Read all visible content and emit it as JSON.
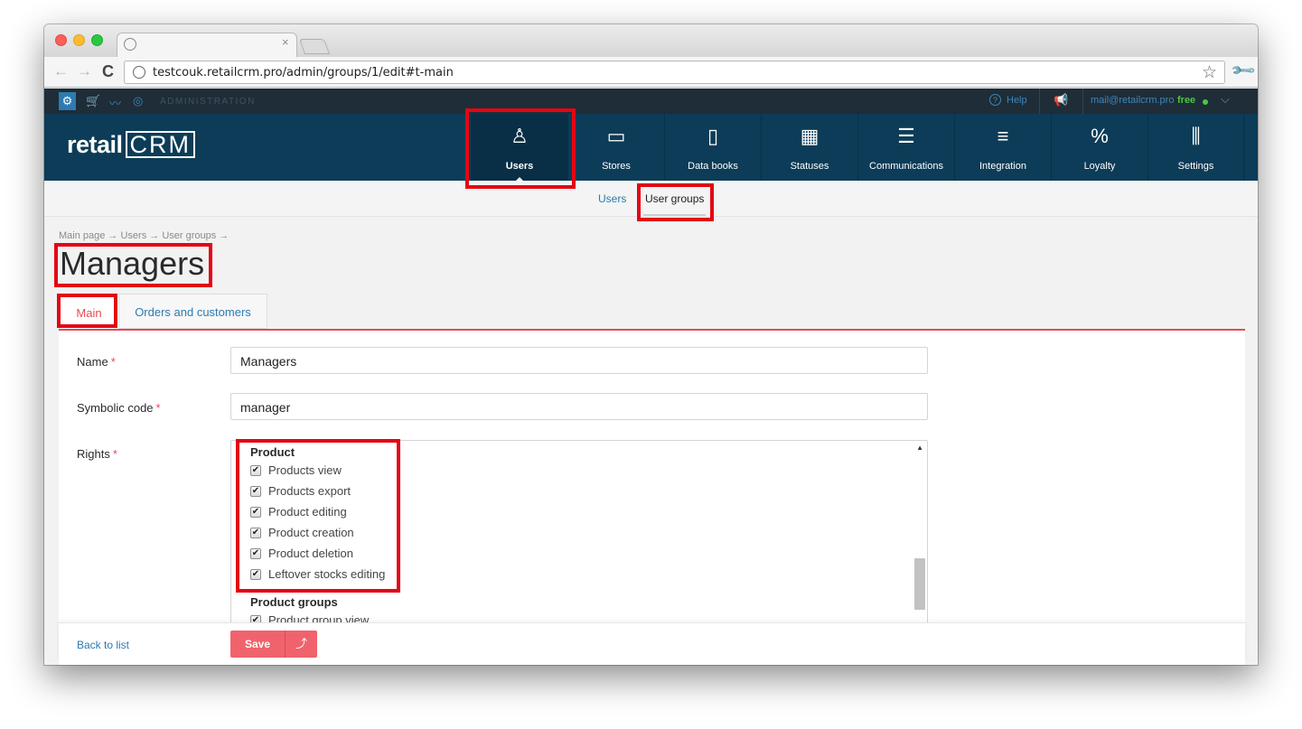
{
  "browser": {
    "url": "testcouk.retailcrm.pro/admin/groups/1/edit#t-main",
    "tab_close": "×"
  },
  "adminbar": {
    "label": "ADMINISTRATION",
    "help": "Help",
    "email": "mail@retailcrm.pro",
    "plan": "free"
  },
  "logo": {
    "text": "retail",
    "crm": "CRM"
  },
  "nav": {
    "items": [
      {
        "label": "Users",
        "icon": "user-icon",
        "active": true
      },
      {
        "label": "Stores",
        "icon": "store-icon"
      },
      {
        "label": "Data books",
        "icon": "book-icon"
      },
      {
        "label": "Statuses",
        "icon": "statuses-icon"
      },
      {
        "label": "Communications",
        "icon": "communications-icon"
      },
      {
        "label": "Integration",
        "icon": "integration-icon"
      },
      {
        "label": "Loyalty",
        "icon": "loyalty-icon"
      },
      {
        "label": "Settings",
        "icon": "settings-sliders-icon"
      }
    ]
  },
  "subnav": {
    "users": "Users",
    "user_groups": "User groups"
  },
  "breadcrumb": "Main page → Users → User groups →",
  "page_title": "Managers",
  "tabs": {
    "main": "Main",
    "orders": "Orders and customers"
  },
  "form": {
    "name_label": "Name",
    "name_value": "Managers",
    "code_label": "Symbolic code",
    "code_value": "manager",
    "rights_label": "Rights",
    "required_mark": "*"
  },
  "rights": {
    "group1": "Product",
    "items": [
      "Products view",
      "Products export",
      "Product editing",
      "Product creation",
      "Product deletion",
      "Leftover stocks editing"
    ],
    "group2": "Product groups",
    "group2_items": [
      "Product group view"
    ]
  },
  "footer": {
    "back": "Back to list",
    "save": "Save"
  }
}
